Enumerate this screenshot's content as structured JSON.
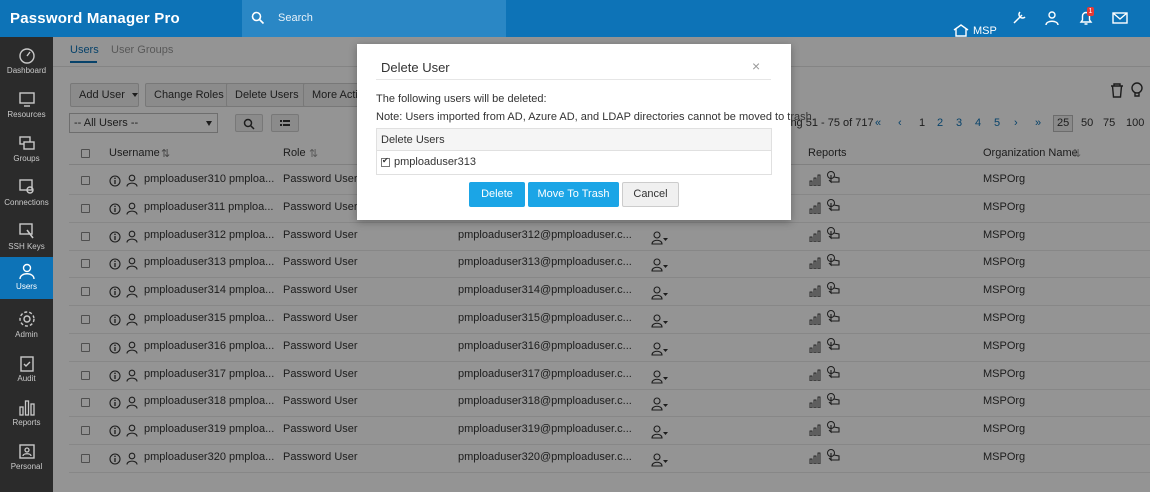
{
  "app": {
    "title": "Password Manager Pro"
  },
  "search": {
    "placeholder": "Search"
  },
  "header": {
    "org": "MSP",
    "notification_count": "1"
  },
  "sidebar": {
    "items": [
      {
        "label": "Dashboard",
        "icon": "dashboard-icon"
      },
      {
        "label": "Resources",
        "icon": "monitor-icon"
      },
      {
        "label": "Groups",
        "icon": "groups-icon"
      },
      {
        "label": "Connections",
        "icon": "connections-icon"
      },
      {
        "label": "SSH Keys",
        "icon": "ssh-key-icon"
      },
      {
        "label": "Users",
        "icon": "user-icon"
      },
      {
        "label": "Admin",
        "icon": "gear-icon"
      },
      {
        "label": "Audit",
        "icon": "clipboard-icon"
      },
      {
        "label": "Reports",
        "icon": "bar-chart-icon"
      },
      {
        "label": "Personal",
        "icon": "id-card-icon"
      }
    ]
  },
  "tabs": [
    {
      "label": "Users"
    },
    {
      "label": "User Groups"
    }
  ],
  "toolbar": {
    "add_user": "Add User",
    "change_roles": "Change Roles",
    "delete_users": "Delete Users",
    "more_actions": "More Acti",
    "filter_value": "-- All Users --"
  },
  "pagination": {
    "showing": "ing 51 - 75 of 717",
    "pages": [
      "1",
      "2",
      "3",
      "4",
      "5"
    ],
    "sizes": [
      "25",
      "50",
      "75",
      "100"
    ],
    "selected_size": "25"
  },
  "table": {
    "headers": {
      "username": "Username",
      "role": "Role",
      "reports": "Reports",
      "org": "Organization Name"
    },
    "rows": [
      {
        "username": "pmploaduser310 pmploa...",
        "role": "Password User",
        "email": "",
        "org": "MSPOrg"
      },
      {
        "username": "pmploaduser311 pmploa...",
        "role": "Password User",
        "email": "",
        "org": "MSPOrg"
      },
      {
        "username": "pmploaduser312 pmploa...",
        "role": "Password User",
        "email": "pmploaduser312@pmploaduser.c...",
        "org": "MSPOrg"
      },
      {
        "username": "pmploaduser313 pmploa...",
        "role": "Password User",
        "email": "pmploaduser313@pmploaduser.c...",
        "org": "MSPOrg"
      },
      {
        "username": "pmploaduser314 pmploa...",
        "role": "Password User",
        "email": "pmploaduser314@pmploaduser.c...",
        "org": "MSPOrg"
      },
      {
        "username": "pmploaduser315 pmploa...",
        "role": "Password User",
        "email": "pmploaduser315@pmploaduser.c...",
        "org": "MSPOrg"
      },
      {
        "username": "pmploaduser316 pmploa...",
        "role": "Password User",
        "email": "pmploaduser316@pmploaduser.c...",
        "org": "MSPOrg"
      },
      {
        "username": "pmploaduser317 pmploa...",
        "role": "Password User",
        "email": "pmploaduser317@pmploaduser.c...",
        "org": "MSPOrg"
      },
      {
        "username": "pmploaduser318 pmploa...",
        "role": "Password User",
        "email": "pmploaduser318@pmploaduser.c...",
        "org": "MSPOrg"
      },
      {
        "username": "pmploaduser319 pmploa...",
        "role": "Password User",
        "email": "pmploaduser319@pmploaduser.c...",
        "org": "MSPOrg"
      },
      {
        "username": "pmploaduser320 pmploa...",
        "role": "Password User",
        "email": "pmploaduser320@pmploaduser.c...",
        "org": "MSPOrg"
      }
    ]
  },
  "dialog": {
    "title": "Delete User",
    "close": "×",
    "line1": "The following users will be deleted:",
    "line2": "Note: Users imported from AD, Azure AD, and LDAP directories cannot be moved to trash.",
    "table_header": "Delete Users",
    "user": "pmploaduser313",
    "delete_label": "Delete",
    "trash_label": "Move To Trash",
    "cancel_label": "Cancel"
  },
  "colors": {
    "brand": "#0d73b7",
    "sidebar": "#2b2b2b",
    "primary_button": "#1ba5e6"
  }
}
